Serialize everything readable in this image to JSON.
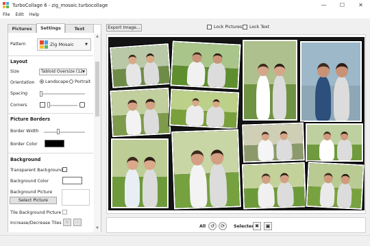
{
  "window": {
    "title": "TurboCollage 6 - zig_mosaic.turbocollage",
    "controls": [
      "minimize",
      "maximize",
      "close"
    ]
  },
  "menu": [
    "File",
    "Edit",
    "Help"
  ],
  "tabs": [
    {
      "label": "Pictures",
      "active": false
    },
    {
      "label": "Settings",
      "active": true
    },
    {
      "label": "Text",
      "active": false
    }
  ],
  "settings": {
    "pattern_label": "Pattern",
    "pattern_value": "Zig Mosaic",
    "layout_heading": "Layout",
    "size_label": "Size",
    "size_value": "Tabloid Oversize (12",
    "orientation_label": "Orientation",
    "orientation_landscape": "Landscape",
    "orientation_portrait": "Portrait",
    "orientation_selected": "Landscape",
    "spacing_label": "Spacing",
    "corners_label": "Corners",
    "borders_heading": "Picture Borders",
    "border_width_label": "Border Width",
    "border_color_label": "Border Color",
    "border_color": "#000000",
    "background_heading": "Background",
    "transparent_bg_label": "Transparent Background",
    "transparent_bg_checked": false,
    "bg_color_label": "Background Color",
    "bg_color": "#ffffff",
    "bg_picture_label": "Background Picture",
    "select_picture_label": "Select Picture",
    "tile_bg_label": "Tile Background Picture",
    "tile_bg_checked": false,
    "inc_dec_label": "Increase/Decrease Tiles",
    "inc_symbol": "+",
    "dec_symbol": "-"
  },
  "toolbar": {
    "export_label": "Export Image...",
    "lock_pictures_label": "Lock Pictures",
    "lock_text_label": "Lock Text",
    "lock_pictures_checked": false,
    "lock_text_checked": false
  },
  "bottom_bar": {
    "all_label": "All",
    "selected_label": "Selected"
  },
  "colors": {
    "accent": "#3a6fb0",
    "collage_border": "#141414"
  }
}
